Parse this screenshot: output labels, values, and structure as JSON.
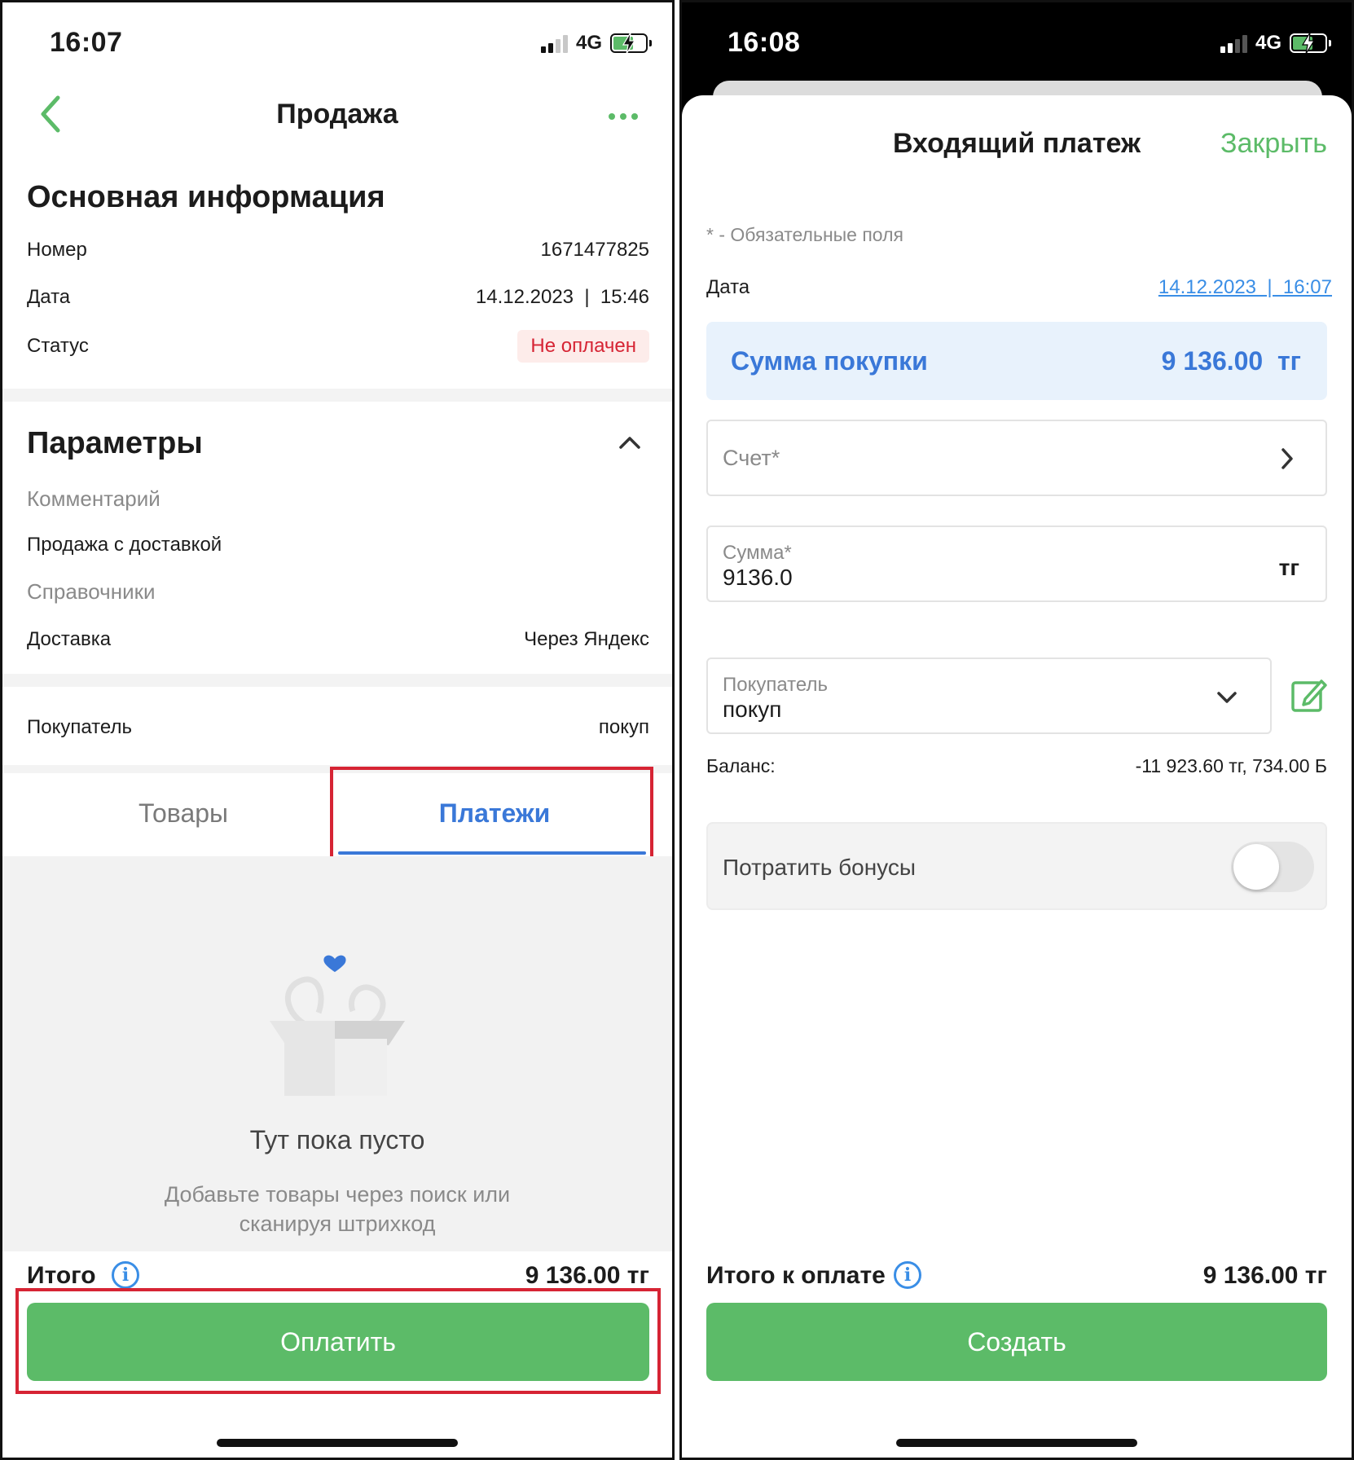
{
  "colors": {
    "accent_green": "#5cbb68",
    "accent_blue": "#3a78d8",
    "status_red": "#d62434",
    "status_red_bg": "#fdecea",
    "summary_bg": "#e8f2fc"
  },
  "left": {
    "status_bar": {
      "time": "16:07",
      "network": "4G"
    },
    "nav": {
      "title": "Продажа",
      "back_icon": "chevron-left-icon",
      "more_icon": "more-dots-icon"
    },
    "main_info": {
      "title": "Основная информация",
      "rows": [
        {
          "label": "Номер",
          "value": "1671477825"
        },
        {
          "label": "Дата",
          "value": "14.12.2023  |  15:46"
        },
        {
          "label": "Статус",
          "value": "Не оплачен"
        }
      ]
    },
    "params": {
      "title": "Параметры",
      "comment_label": "Комментарий",
      "comment_value": "Продажа с доставкой",
      "refs_label": "Справочники",
      "delivery_label": "Доставка",
      "delivery_value": "Через Яндекс"
    },
    "buyer": {
      "label": "Покупатель",
      "value": "покуп"
    },
    "tabs": [
      {
        "label": "Товары",
        "active": false
      },
      {
        "label": "Платежи",
        "active": true
      }
    ],
    "empty": {
      "title": "Тут пока пусто",
      "line1": "Добавьте товары через поиск или",
      "line2": "сканируя штрихкод"
    },
    "total": {
      "label": "Итого",
      "value": "9 136.00 тг"
    },
    "pay_button": "Оплатить"
  },
  "right": {
    "status_bar": {
      "time": "16:08",
      "network": "4G"
    },
    "header": {
      "title": "Входящий платеж",
      "close_label": "Закрыть"
    },
    "required_note": "* - Обязательные поля",
    "date": {
      "label": "Дата",
      "value": "14.12.2023  |  16:07"
    },
    "summary": {
      "label": "Сумма покупки",
      "value": "9 136.00  тг"
    },
    "account_field": {
      "placeholder": "Счет*"
    },
    "amount_field": {
      "label": "Сумма*",
      "value": "9136.0",
      "unit": "тг"
    },
    "buyer_field": {
      "label": "Покупатель",
      "value": "покуп"
    },
    "balance": {
      "label": "Баланс:",
      "value": "-11 923.60 тг, 734.00 Б"
    },
    "bonus_toggle": {
      "label": "Потратить бонусы",
      "on": false
    },
    "total": {
      "label": "Итого к оплате",
      "value": "9 136.00 тг"
    },
    "create_button": "Создать"
  }
}
